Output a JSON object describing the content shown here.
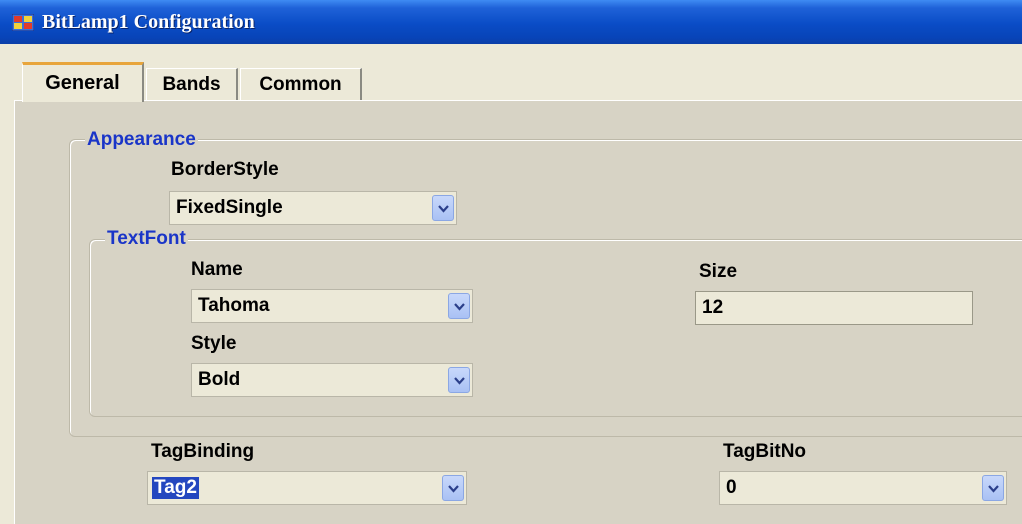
{
  "window": {
    "title": "BitLamp1 Configuration",
    "icon": "app-window-icon"
  },
  "tabs": [
    {
      "label": "General",
      "active": true
    },
    {
      "label": "Bands",
      "active": false
    },
    {
      "label": "Common",
      "active": false
    }
  ],
  "appearance": {
    "legend": "Appearance",
    "border_style": {
      "label": "BorderStyle",
      "value": "FixedSingle"
    },
    "text_font": {
      "legend": "TextFont",
      "name": {
        "label": "Name",
        "value": "Tahoma"
      },
      "size": {
        "label": "Size",
        "value": "12"
      },
      "style": {
        "label": "Style",
        "value": "Bold"
      }
    }
  },
  "tag_binding": {
    "label": "TagBinding",
    "value": "Tag2"
  },
  "tag_bit_no": {
    "label": "TagBitNo",
    "value": "0"
  },
  "colors": {
    "accent": "#1a35c8",
    "tab_highlight": "#e8a53b",
    "title_bar": "#0a4cc6",
    "selection": "#2447bf"
  }
}
